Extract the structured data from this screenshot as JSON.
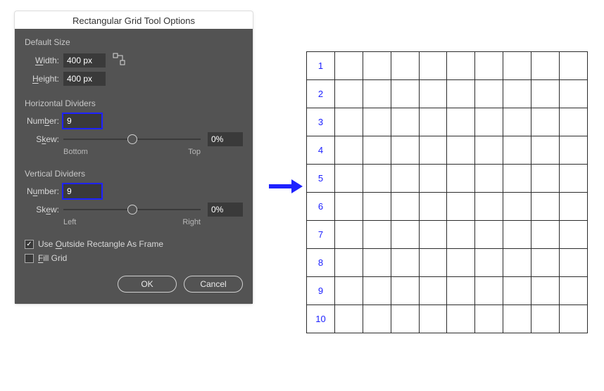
{
  "dialog": {
    "title": "Rectangular Grid Tool Options",
    "defaultSize": {
      "heading": "Default Size",
      "widthLabelPrefix": "W",
      "widthLabelRest": "idth:",
      "widthValue": "400 px",
      "heightLabelPrefix": "H",
      "heightLabelRest": "eight:",
      "heightValue": "400 px"
    },
    "horizontal": {
      "heading": "Horizontal Dividers",
      "numberLabelPrefix": "Num",
      "numberLabelMid": "b",
      "numberLabelRest": "er:",
      "numberValue": "9",
      "skewLabelPrefix": "S",
      "skewLabelMid": "k",
      "skewLabelRest": "ew:",
      "skewValue": "0%",
      "leftEnd": "Bottom",
      "rightEnd": "Top"
    },
    "vertical": {
      "heading": "Vertical Dividers",
      "numberLabelPrefix": "N",
      "numberLabelMid": "u",
      "numberLabelRest": "mber:",
      "numberValue": "9",
      "skewLabelPrefix": "Sk",
      "skewLabelMid": "e",
      "skewLabelRest": "w:",
      "skewValue": "0%",
      "leftEnd": "Left",
      "rightEnd": "Right"
    },
    "options": {
      "outsideLabelPrefix": "Use ",
      "outsideLabelMid": "O",
      "outsideLabelRest": "utside Rectangle As Frame",
      "outsideChecked": true,
      "fillLabelPrefix": "F",
      "fillLabelRest": "ill Grid",
      "fillChecked": false
    },
    "buttons": {
      "ok": "OK",
      "cancel": "Cancel"
    }
  },
  "grid": {
    "rowNumbers": [
      "1",
      "2",
      "3",
      "4",
      "5",
      "6",
      "7",
      "8",
      "9",
      "10"
    ],
    "cols": 10
  }
}
